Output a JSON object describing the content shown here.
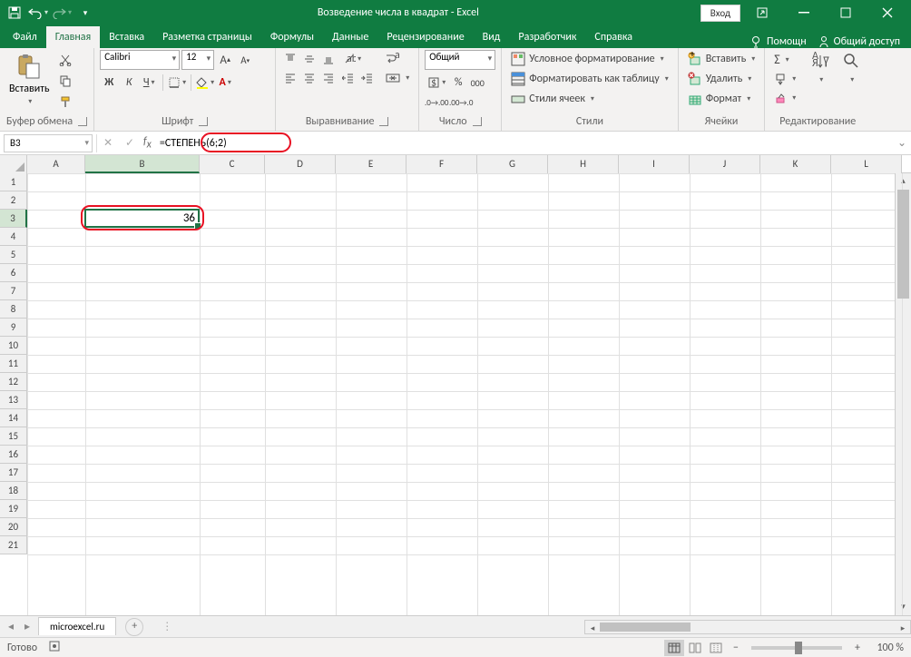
{
  "title": "Возведение числа в квадрат  -  Excel",
  "login": "Вход",
  "tabs": {
    "file": "Файл",
    "home": "Главная",
    "insert": "Вставка",
    "layout": "Разметка страницы",
    "formulas": "Формулы",
    "data": "Данные",
    "review": "Рецензирование",
    "view": "Вид",
    "developer": "Разработчик",
    "help": "Справка",
    "tell": "Помощн",
    "share": "Общий доступ"
  },
  "ribbon": {
    "paste": "Вставить",
    "clipboard": "Буфер обмена",
    "font_name": "Calibri",
    "font_size": "12",
    "font_label": "Шрифт",
    "align_label": "Выравнивание",
    "number_format": "Общий",
    "number_label": "Число",
    "cond_fmt": "Условное форматирование",
    "as_table": "Форматировать как таблицу",
    "cell_styles": "Стили ячеек",
    "styles_label": "Стили",
    "insert_btn": "Вставить",
    "delete_btn": "Удалить",
    "format_btn": "Формат",
    "cells_label": "Ячейки",
    "editing_label": "Редактирование"
  },
  "name_box": "B3",
  "formula": "=СТЕПЕНЬ(6;2)",
  "columns": [
    "A",
    "B",
    "C",
    "D",
    "E",
    "F",
    "G",
    "H",
    "I",
    "J",
    "K",
    "L"
  ],
  "rows": [
    "1",
    "2",
    "3",
    "4",
    "5",
    "6",
    "7",
    "8",
    "9",
    "10",
    "11",
    "12",
    "13",
    "14",
    "15",
    "16",
    "17",
    "18",
    "19",
    "20",
    "21"
  ],
  "cell_b3": "36",
  "sheet_name": "microexcel.ru",
  "status": "Готово",
  "zoom": "100 %"
}
